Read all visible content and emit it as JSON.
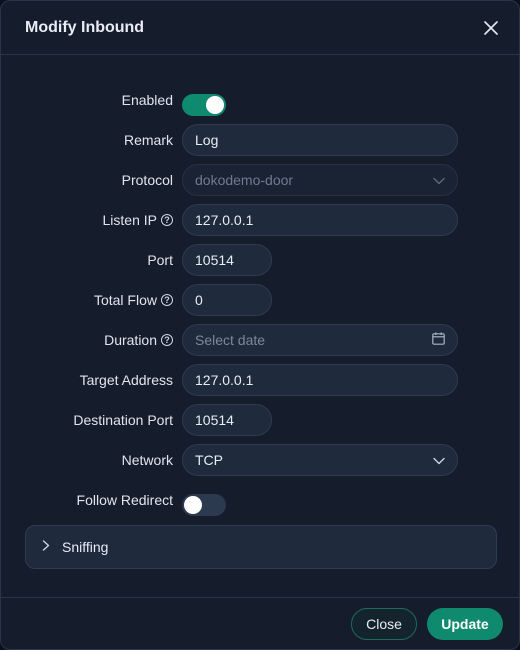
{
  "modal": {
    "title": "Modify Inbound"
  },
  "fields": {
    "enabled": {
      "label": "Enabled",
      "value": true
    },
    "remark": {
      "label": "Remark",
      "value": "Log"
    },
    "protocol": {
      "label": "Protocol",
      "value": "dokodemo-door"
    },
    "listen_ip": {
      "label": "Listen IP",
      "value": "127.0.0.1"
    },
    "port": {
      "label": "Port",
      "value": "10514"
    },
    "total_flow": {
      "label": "Total Flow",
      "value": "0"
    },
    "duration": {
      "label": "Duration",
      "placeholder": "Select date"
    },
    "target_address": {
      "label": "Target Address",
      "value": "127.0.0.1"
    },
    "destination_port": {
      "label": "Destination Port",
      "value": "10514"
    },
    "network": {
      "label": "Network",
      "value": "TCP"
    },
    "follow_redirect": {
      "label": "Follow Redirect",
      "value": false
    }
  },
  "sniffing": {
    "label": "Sniffing"
  },
  "footer": {
    "close_label": "Close",
    "update_label": "Update"
  },
  "help_glyph": "?",
  "colors": {
    "accent": "#0f8a6f",
    "background": "#151d2c",
    "input_background": "#1f2a3c"
  }
}
